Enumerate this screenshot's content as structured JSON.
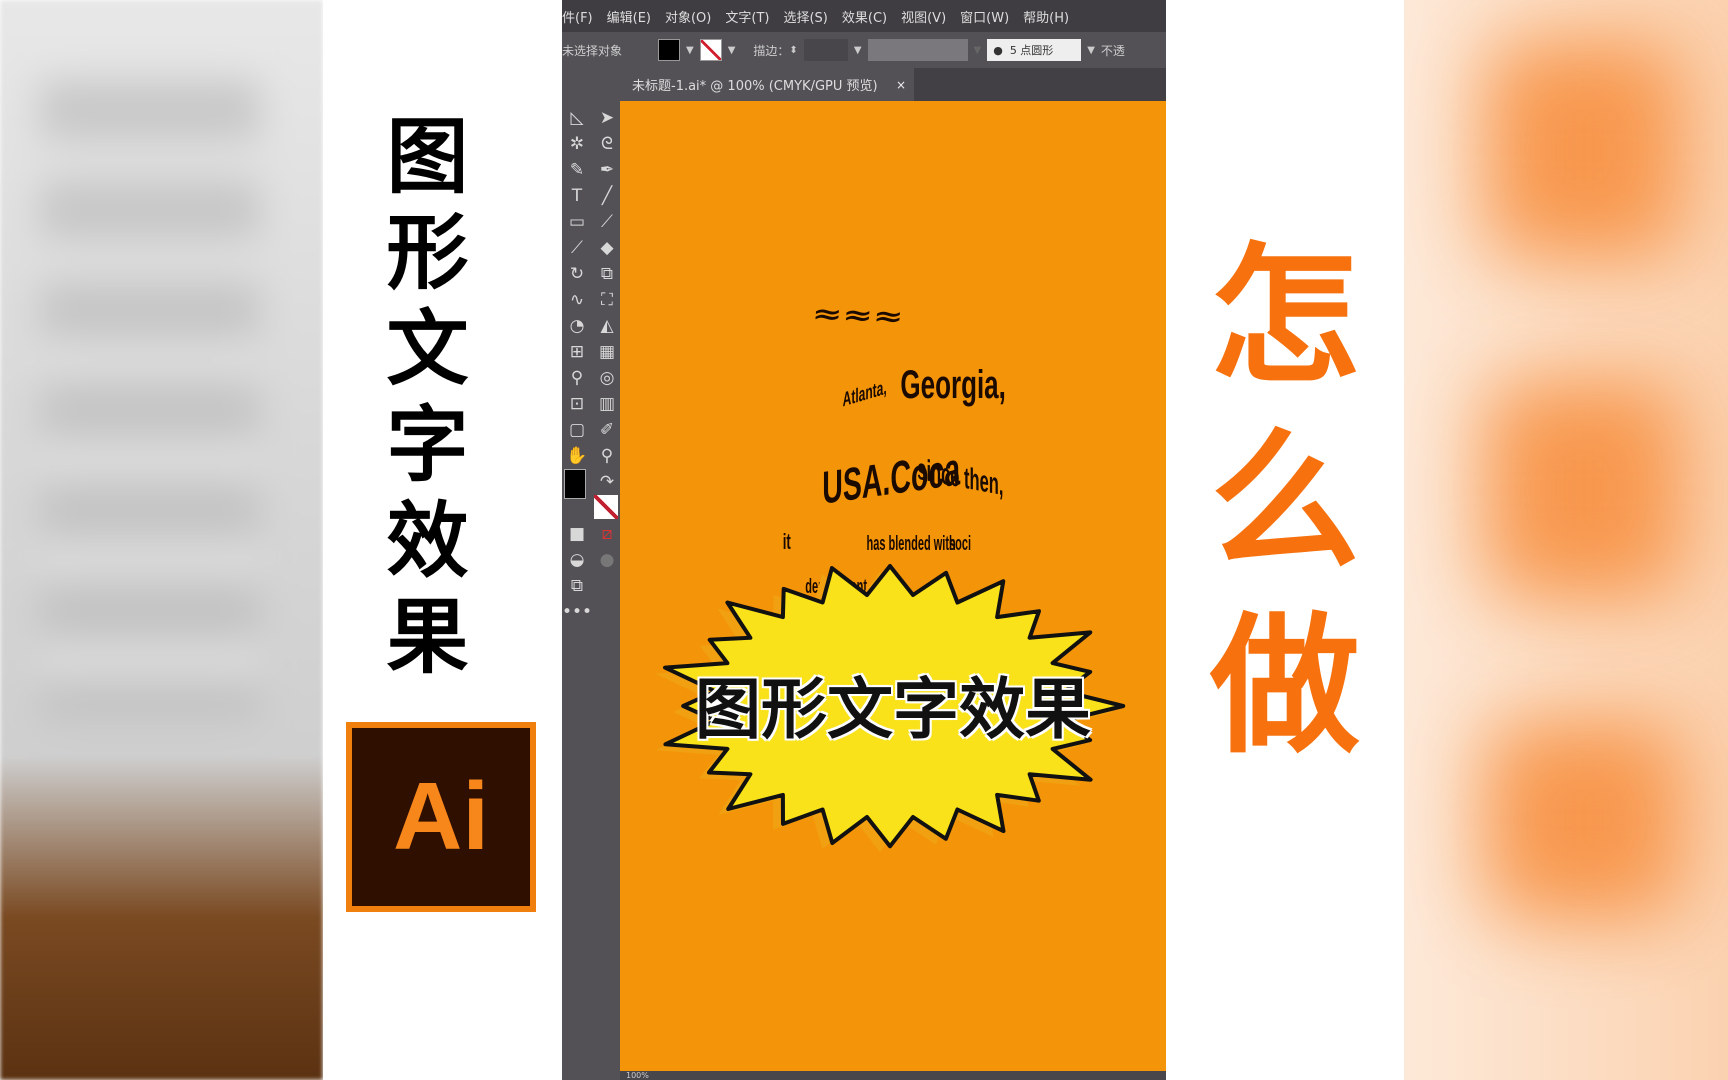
{
  "left_title": [
    "图",
    "形",
    "文",
    "字",
    "效",
    "果"
  ],
  "logo_text": "Ai",
  "right_title": [
    "怎",
    "么",
    "做"
  ],
  "menu": [
    "件(F)",
    "编辑(E)",
    "对象(O)",
    "文字(T)",
    "选择(S)",
    "效果(C)",
    "视图(V)",
    "窗口(W)",
    "帮助(H)"
  ],
  "control": {
    "selection": "未选择对象",
    "stroke_label": "描边：",
    "brush": "5 点圆形",
    "opacity": "不透"
  },
  "tab": {
    "title": "未标题-1.ai* @ 100% (CMYK/GPU 预览)",
    "close": "×"
  },
  "status": {
    "zoom": "100%"
  },
  "bottle_words": [
    "Atlanta,",
    "Georgia,",
    "USA.Coca",
    "since then,",
    "it",
    "has blended with",
    "soci",
    "deployment"
  ],
  "burst_text": "图形文字效果",
  "colors": {
    "canvas": "#f49408",
    "accent_right": "#f7720f",
    "burst": "#f9e21a",
    "logo_bg": "#2e0f00",
    "logo_border": "#f07f0d"
  }
}
